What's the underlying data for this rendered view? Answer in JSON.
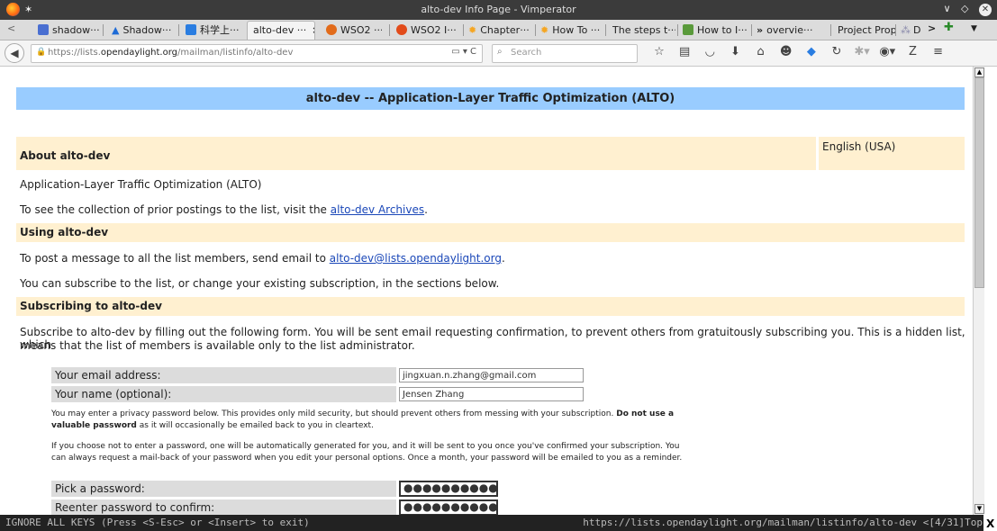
{
  "window": {
    "title": "alto-dev Info Page - Vimperator"
  },
  "tabs": [
    {
      "label": "shadow···",
      "fav_color": "#4a6fd1"
    },
    {
      "label": "Shadow···",
      "fav_color": "#1e6bd6"
    },
    {
      "label": "科学上···",
      "fav_color": "#2a7de1"
    },
    {
      "label": "alto-dev ···",
      "active": true
    },
    {
      "label": "WSO2 ···",
      "fav_color": "#e26b1a"
    },
    {
      "label": "WSO2 I···",
      "fav_color": "#e24b1a"
    },
    {
      "label": "Chapter···",
      "fav_color": "#f5a623"
    },
    {
      "label": "How To ···",
      "fav_color": "#f5a623"
    },
    {
      "label": "The steps t···"
    },
    {
      "label": "How to I···",
      "fav_color": "#5a9a3b"
    },
    {
      "label": "overvie···"
    },
    {
      "label": "Project Prop···"
    },
    {
      "label": "D"
    }
  ],
  "navbar": {
    "url_prefix": "https://lists.",
    "url_domain": "opendaylight.org",
    "url_path": "/mailman/listinfo/alto-dev",
    "search_placeholder": "Search"
  },
  "page": {
    "banner": "alto-dev -- Application-Layer Traffic Optimization (ALTO)",
    "about_heading": "About alto-dev",
    "language": "English (USA)",
    "about_text": "Application-Layer Traffic Optimization (ALTO)",
    "archives_pre": "To see the collection of prior postings to the list, visit the ",
    "archives_link": "alto-dev Archives",
    "archives_post": ".",
    "using_heading": "Using alto-dev",
    "post_pre": "To post a message to all the list members, send email to ",
    "post_link": "alto-dev@lists.opendaylight.org",
    "post_post": ".",
    "subscribe_change": "You can subscribe to the list, or change your existing subscription, in the sections below.",
    "subscribing_heading": "Subscribing to alto-dev",
    "subscribe_text_1": "Subscribe to alto-dev by filling out the following form. You will be sent email requesting confirmation, to prevent others from gratuitously subscribing you. This is a hidden list, which",
    "subscribe_text_2": "means that the list of members is available only to the list administrator.",
    "email_label": "Your email address:",
    "email_value": "jingxuan.n.zhang@gmail.com",
    "name_label": "Your name (optional):",
    "name_value": "Jensen Zhang",
    "privacy_1_pre": "You may enter a privacy password below. This provides only mild security, but should prevent others from messing with your subscription. ",
    "privacy_1_bold": "Do not use a",
    "privacy_2_bold": "valuable password",
    "privacy_2_post": " as it will occasionally be emailed back to you in cleartext.",
    "auto_1": "If you choose not to enter a password, one will be automatically generated for you, and it will be sent to you once you've confirmed your subscription. You",
    "auto_2": "can always request a mail-back of your password when you edit your personal options. Once a month, your password will be emailed to you as a reminder.",
    "pick_label": "Pick a password:",
    "pick_value": "●●●●●●●●●●",
    "confirm_label": "Reenter password to confirm:",
    "confirm_value": "●●●●●●●●●●"
  },
  "statusline": {
    "mode": "IGNORE ALL KEYS (Press <S-Esc> or <Insert> to exit)",
    "status": "https://lists.opendaylight.org/mailman/listinfo/alto-dev <[4/31]Top"
  },
  "corner_mark": "X"
}
